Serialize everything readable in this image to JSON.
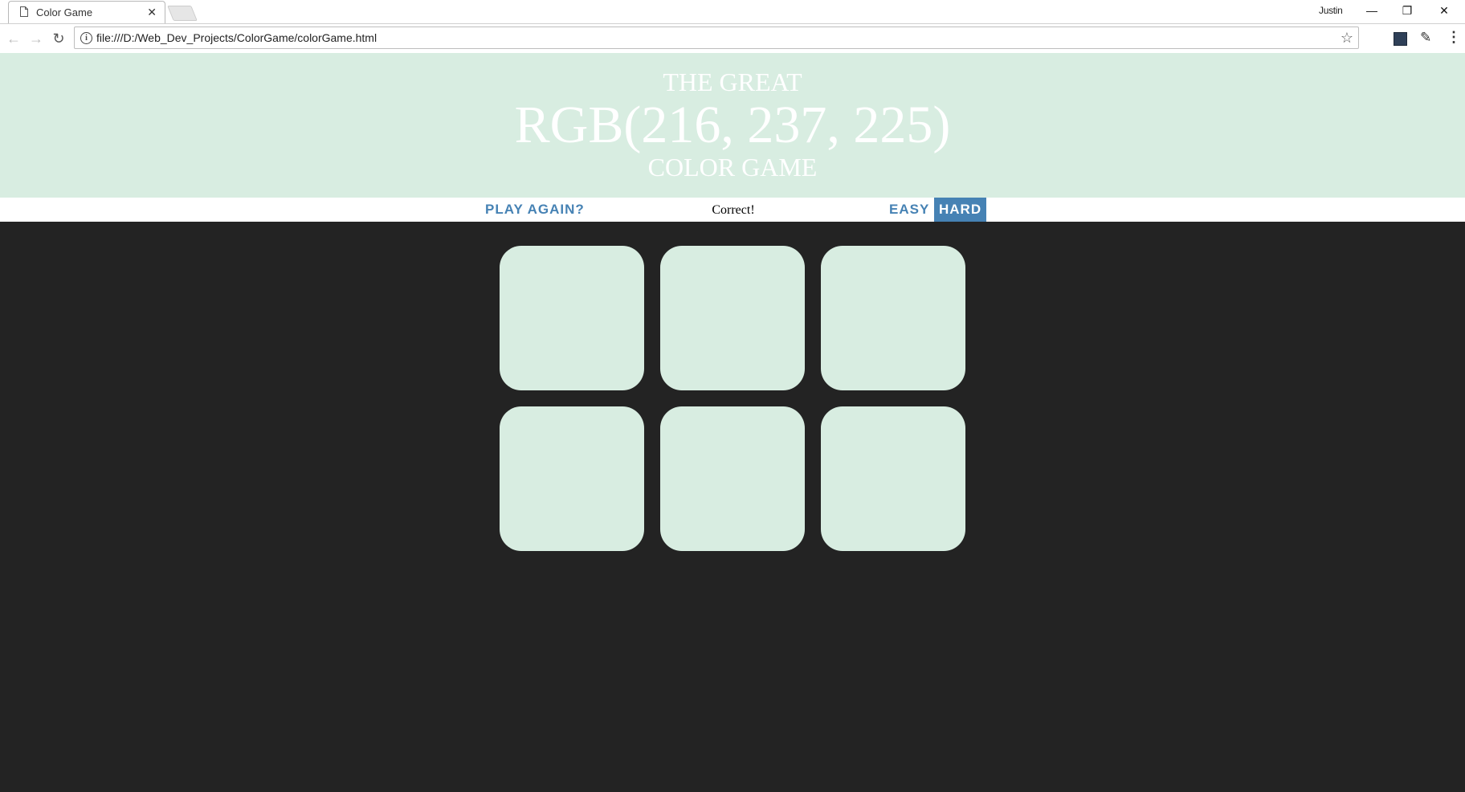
{
  "browser": {
    "tab_title": "Color Game",
    "tab_close": "✕",
    "user_name": "Justin",
    "url": "file:///D:/Web_Dev_Projects/ColorGame/colorGame.html",
    "window_buttons": {
      "minimize": "—",
      "maximize": "❐",
      "close": "✕"
    },
    "icons": [
      "page-icon",
      "back-arrow-icon",
      "forward-arrow-icon",
      "reload-icon",
      "info-icon",
      "star-icon",
      "extension-icon",
      "eyedropper-icon",
      "menu-icon"
    ]
  },
  "game": {
    "header": {
      "line1": "THE GREAT",
      "color_display": "RGB(216, 237, 225)",
      "line3": "COLOR GAME"
    },
    "stripe": {
      "reset_label": "PLAY AGAIN?",
      "message": "Correct!",
      "easy_label": "EASY",
      "hard_label": "HARD",
      "selected_mode": "HARD"
    },
    "squares": [
      "#d8ede1",
      "#d8ede1",
      "#d8ede1",
      "#d8ede1",
      "#d8ede1",
      "#d8ede1"
    ],
    "colors": {
      "header_background": "#d8ede1",
      "page_background": "#232323",
      "accent": "#4682b4"
    }
  }
}
